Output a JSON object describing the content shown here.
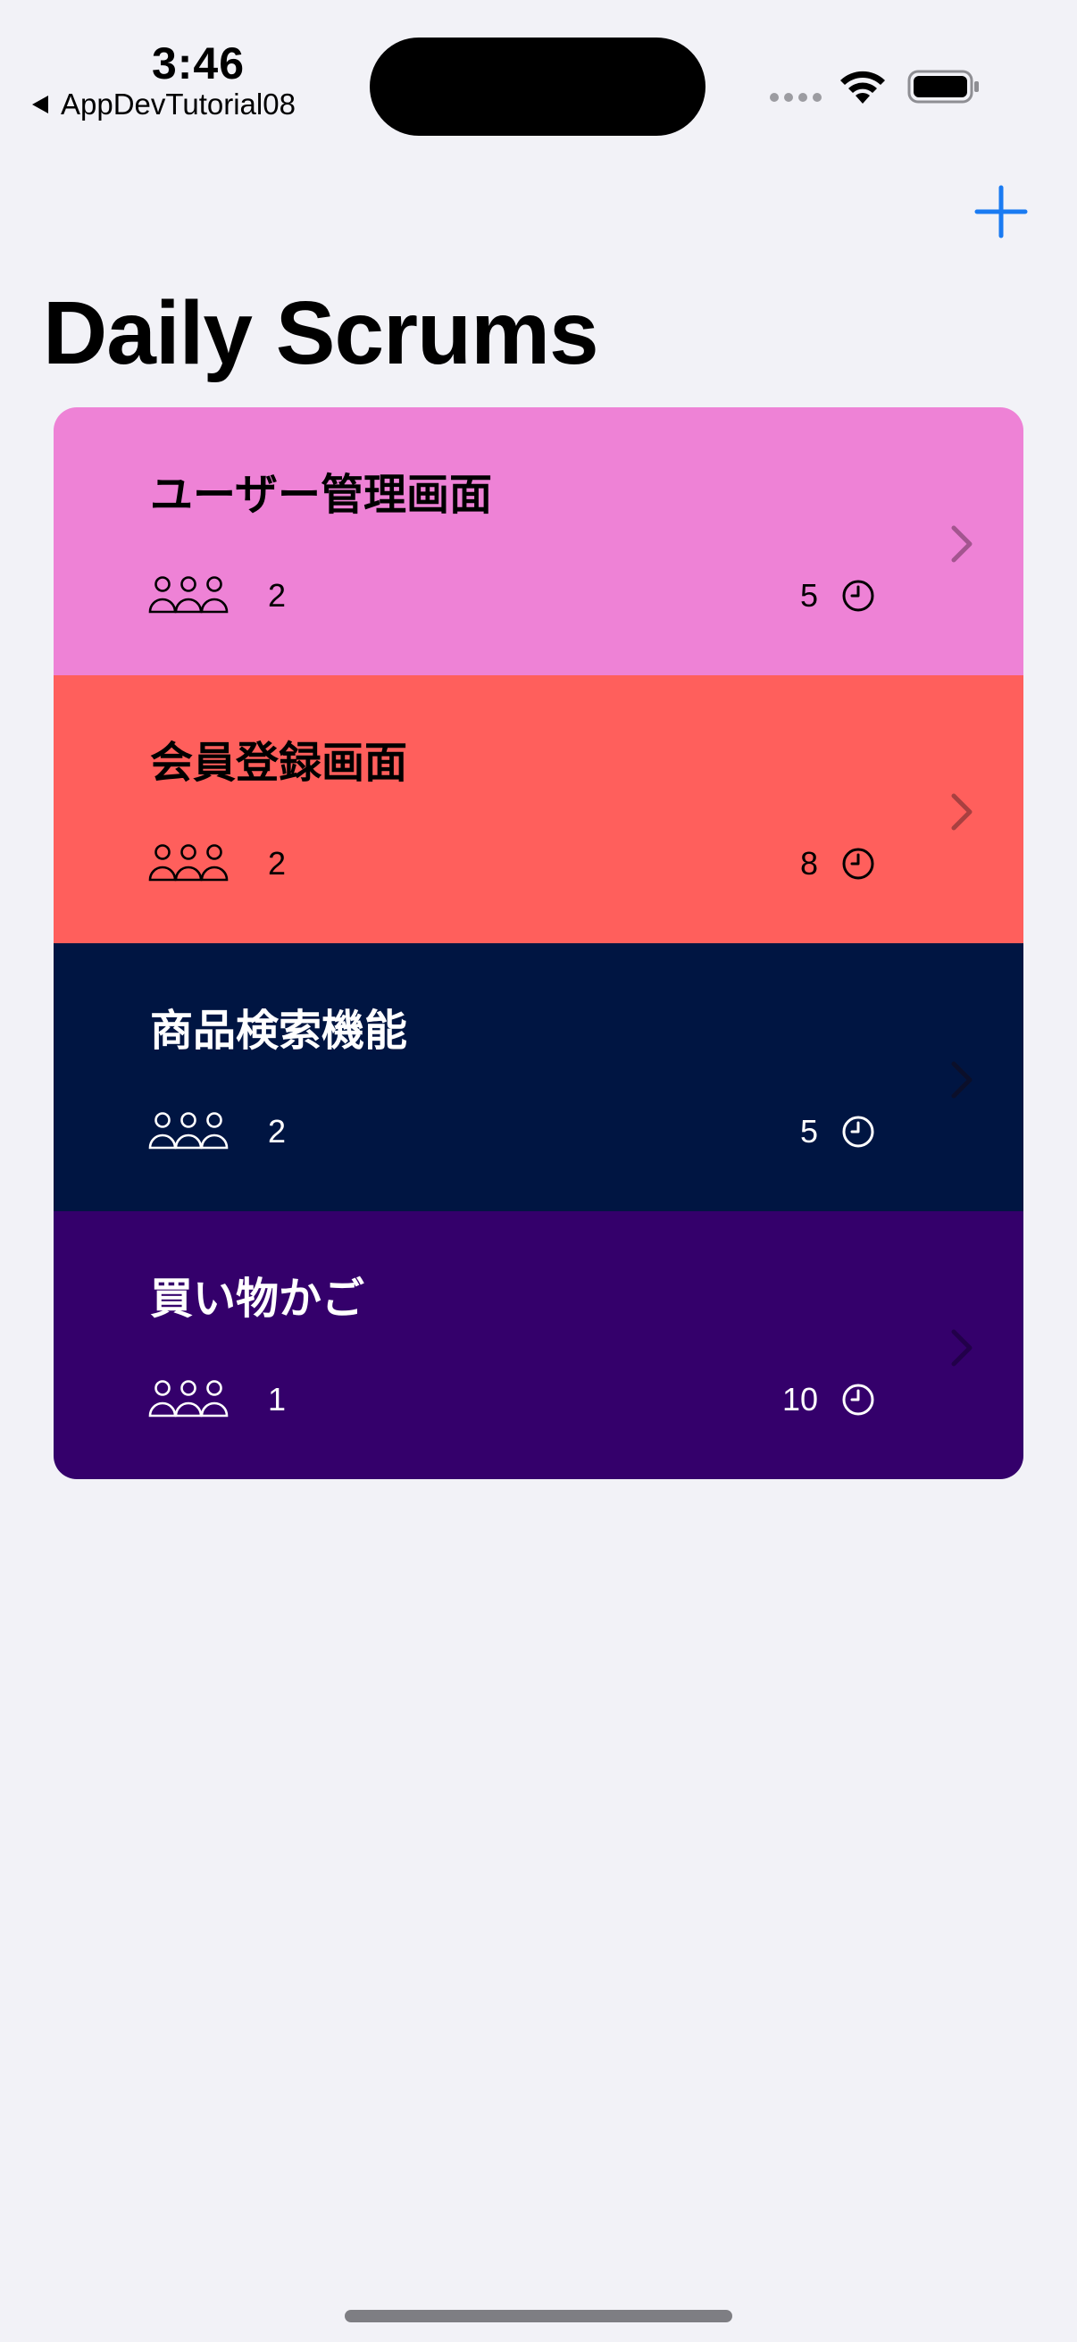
{
  "status_bar": {
    "time": "3:46",
    "back_app": "AppDevTutorial08"
  },
  "nav": {
    "title": "Daily Scrums",
    "add_icon": "plus-icon",
    "accent_color": "#1a7bf2"
  },
  "scrums": [
    {
      "title": "ユーザー管理画面",
      "attendees": "2",
      "minutes": "5",
      "bg": "#ee82d6",
      "fg": "#000000",
      "chevron": "#a3558f"
    },
    {
      "title": "会員登録画面",
      "attendees": "2",
      "minutes": "8",
      "bg": "#ff5f5c",
      "fg": "#000000",
      "chevron": "#a84040"
    },
    {
      "title": "商品検索機能",
      "attendees": "2",
      "minutes": "5",
      "bg": "#001542",
      "fg": "#ffffff",
      "chevron": "#0b0f2a"
    },
    {
      "title": "買い物かご",
      "attendees": "1",
      "minutes": "10",
      "bg": "#34006b",
      "fg": "#ffffff",
      "chevron": "#22004a"
    }
  ],
  "icons": {
    "attendees": "person-3-icon",
    "length": "clock-icon",
    "disclosure": "chevron-right-icon"
  }
}
